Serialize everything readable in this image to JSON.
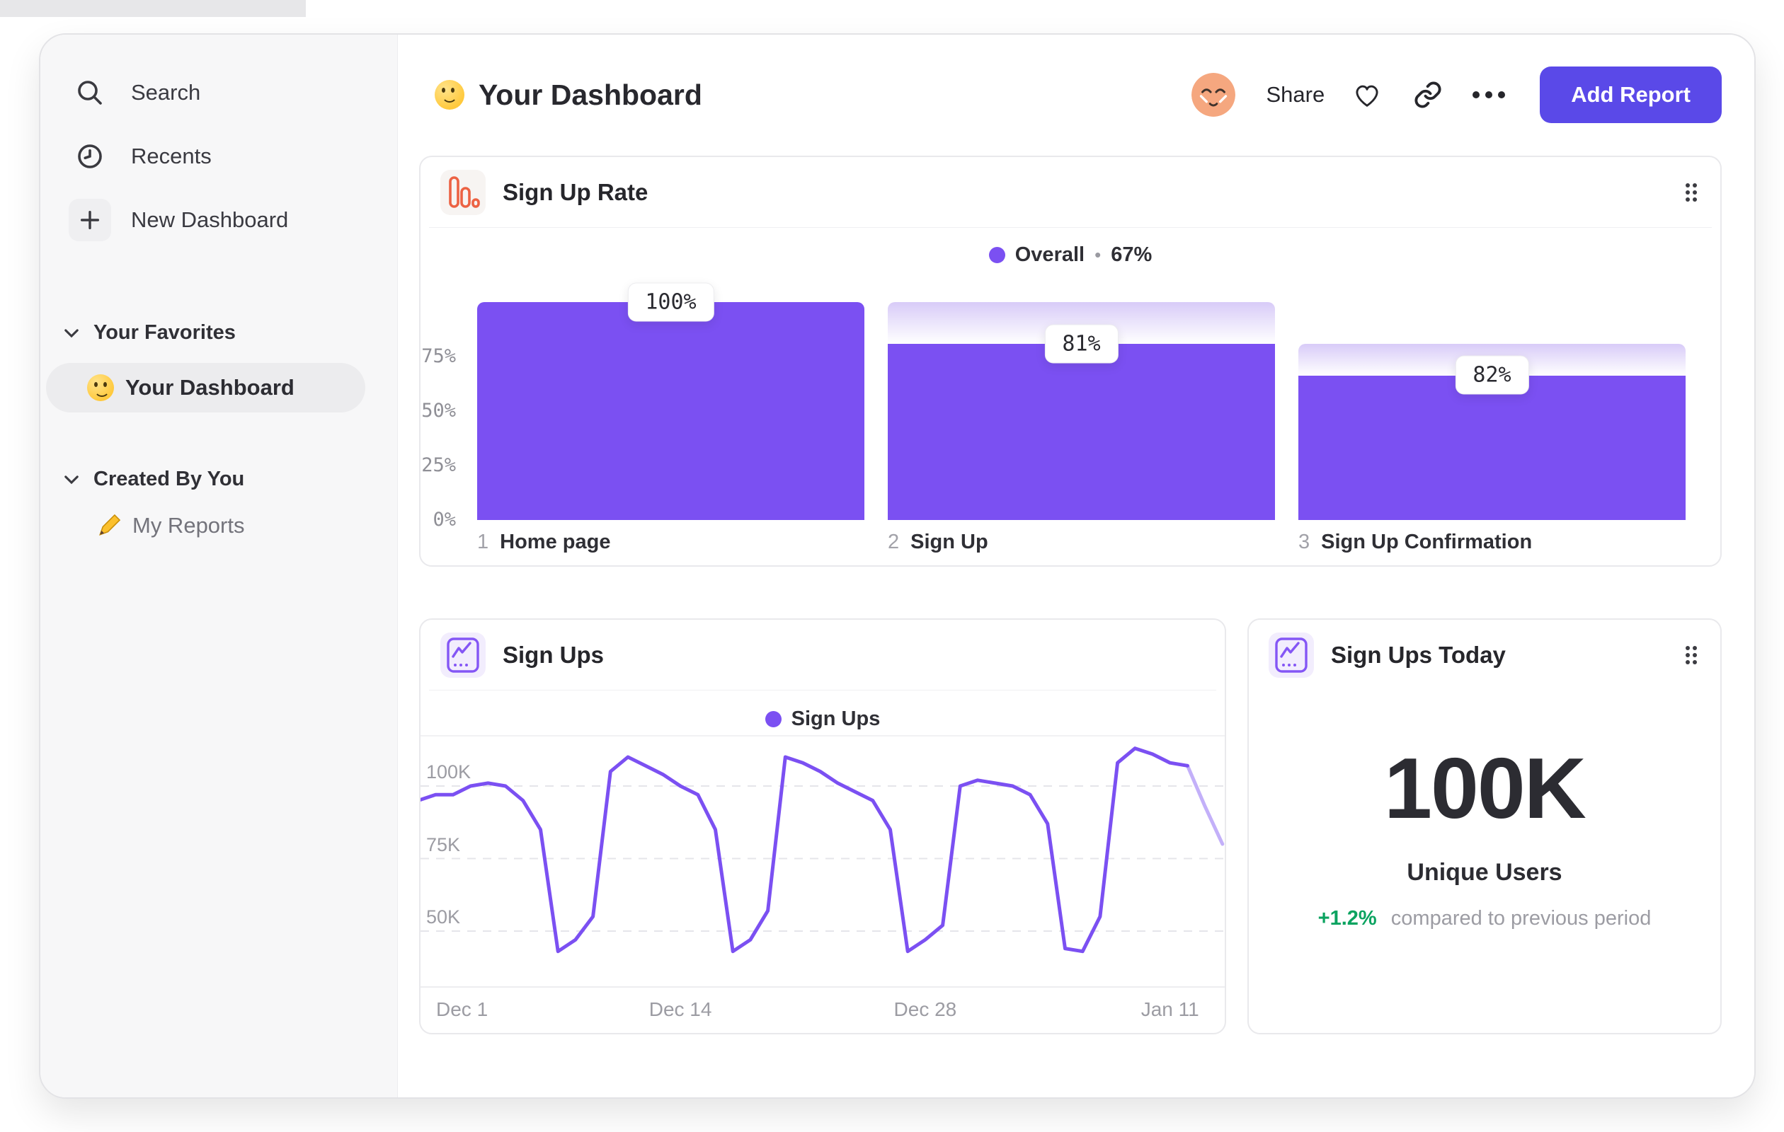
{
  "sidebar": {
    "items": [
      {
        "label": "Search"
      },
      {
        "label": "Recents"
      },
      {
        "label": "New Dashboard"
      }
    ],
    "sections": [
      {
        "label": "Your Favorites",
        "items": [
          {
            "label": "Your Dashboard",
            "selected": true
          }
        ]
      },
      {
        "label": "Created By You",
        "items": [
          {
            "label": "My Reports"
          }
        ]
      }
    ]
  },
  "header": {
    "title": "Your Dashboard",
    "share_label": "Share",
    "add_report_label": "Add Report"
  },
  "cards": {
    "kpi": {
      "title": "Sign Ups Today",
      "value": "100K",
      "caption": "Unique Users",
      "delta": "+1.2%",
      "delta_note": "compared to previous period"
    }
  },
  "colors": {
    "accent_purple": "#7B50F2",
    "button_purple": "#5A49E8",
    "positive_green": "#0BA360",
    "icon_orange": "#EC6243",
    "icon_purple": "#8456F5"
  },
  "chart_data": [
    {
      "type": "bar",
      "id": "sign-up-rate-funnel",
      "title": "Sign Up Rate",
      "legend_series": "Overall",
      "legend_sep": "•",
      "legend_value": "67%",
      "step_numbers": [
        "1",
        "2",
        "3"
      ],
      "categories": [
        "Home page",
        "Sign Up",
        "Sign Up Confirmation"
      ],
      "bar_labels": [
        "100%",
        "81%",
        "82%"
      ],
      "values_pct_of_previous": [
        100,
        81,
        82
      ],
      "cumulative_pct": [
        100,
        81,
        66.4
      ],
      "container_pct": [
        100,
        100,
        81
      ],
      "yticks": [
        "75%",
        "50%",
        "25%",
        "0%"
      ],
      "ytick_values": [
        75,
        50,
        25,
        0
      ],
      "ylim": [
        0,
        100
      ],
      "colors": {
        "bar": "#7B50F2",
        "gradient_top": "#D8CBF8"
      }
    },
    {
      "type": "line",
      "id": "sign-ups-line",
      "title": "Sign Ups",
      "legend": "Sign Ups",
      "color": "#7B50F2",
      "x_tick_labels": [
        "Dec 1",
        "Dec 14",
        "Dec 28",
        "Jan 11"
      ],
      "x_tick_days": [
        0,
        13,
        27,
        41
      ],
      "yticks": [
        {
          "label": "100K",
          "value": 100
        },
        {
          "label": "75K",
          "value": 75
        },
        {
          "label": "50K",
          "value": 50
        }
      ],
      "unit": "K",
      "lead_in_points": 2,
      "faded_from_index": 44,
      "values": [
        95,
        97,
        97,
        100,
        101,
        100,
        95,
        85,
        43,
        47,
        55,
        105,
        110,
        107,
        104,
        100,
        97,
        85,
        43,
        47,
        57,
        110,
        108,
        105,
        101,
        98,
        95,
        85,
        43,
        47,
        52,
        100,
        102,
        101,
        100,
        97,
        87,
        44,
        43,
        55,
        108,
        113,
        111,
        108,
        107,
        93,
        80
      ]
    }
  ]
}
